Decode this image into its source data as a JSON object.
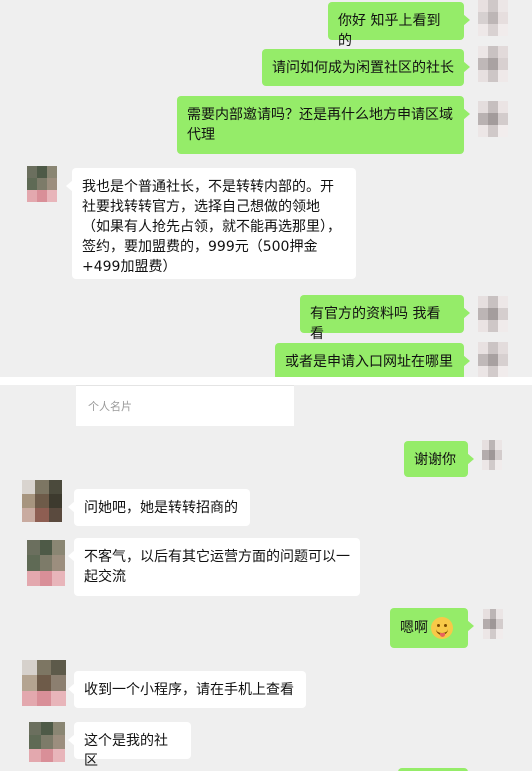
{
  "colors": {
    "sent_bubble": "#95ec69",
    "received_bubble": "#ffffff",
    "chat_background": "#efefef"
  },
  "chat_top": {
    "messages": [
      {
        "sender": "me",
        "text": "你好 知乎上看到的"
      },
      {
        "sender": "me",
        "text": "请问如何成为闲置社区的社长"
      },
      {
        "sender": "me",
        "text": "需要内部邀请吗？还是再什么地方申请区域代理"
      },
      {
        "sender": "other",
        "text": "我也是个普通社长，不是转转内部的。开社要找转转官方，选择自己想做的领地（如果有人抢先占领，就不能再选那里），签约，要加盟费的，999元（500押金+499加盟费）"
      },
      {
        "sender": "me",
        "text": "有官方的资料吗 我看看"
      },
      {
        "sender": "me",
        "text": "或者是申请入口网址在哪里"
      }
    ]
  },
  "chat_bottom": {
    "card_label": "个人名片",
    "messages": [
      {
        "sender": "me",
        "text": "谢谢你"
      },
      {
        "sender": "other",
        "text": "问她吧，她是转转招商的"
      },
      {
        "sender": "other",
        "text": "不客气，以后有其它运营方面的问题可以一起交流"
      },
      {
        "sender": "me",
        "text": "嗯啊",
        "emoji": "grinning-tongue-emoji"
      },
      {
        "sender": "other",
        "text": "收到一个小程序，请在手机上查看"
      },
      {
        "sender": "other",
        "text": "这个是我的社区"
      }
    ]
  }
}
